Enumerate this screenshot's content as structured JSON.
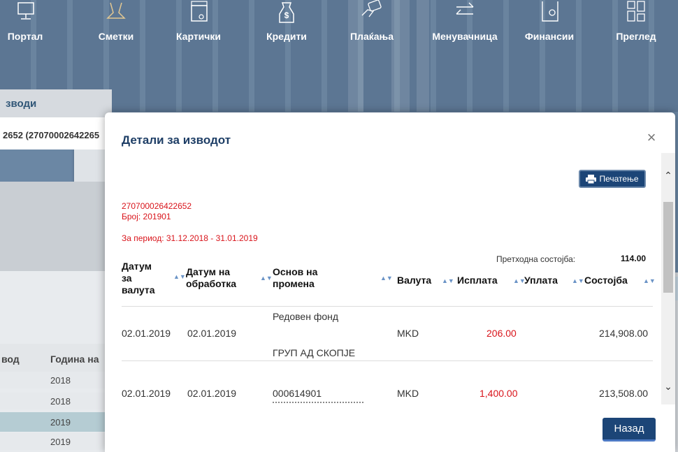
{
  "nav": {
    "items": [
      {
        "label": "Портал",
        "icon": "monitor-icon"
      },
      {
        "label": "Сметки",
        "icon": "users-icon"
      },
      {
        "label": "Картички",
        "icon": "wallet-icon"
      },
      {
        "label": "Кредити",
        "icon": "money-bag-icon"
      },
      {
        "label": "Плаќања",
        "icon": "card-hand-icon"
      },
      {
        "label": "Менувачница",
        "icon": "exchange-icon"
      },
      {
        "label": "Финансии",
        "icon": "safe-icon"
      },
      {
        "label": "Преглед",
        "icon": "dashboard-icon"
      }
    ]
  },
  "background": {
    "section_title": "зводи",
    "account_text": "2652 (27070002642265",
    "col_izvod": "вод",
    "col_year": "Година на",
    "years": [
      "2018",
      "2018",
      "2019",
      "2019"
    ],
    "highlighted_row": 2
  },
  "modal": {
    "title": "Детали за изводот",
    "print_label": "Печатење",
    "account_number": "270700026422652",
    "number_label": "Број:  201901",
    "period_label": "За период:  31.12.2018 - 31.01.2019",
    "prev_balance_label": "Претходна состојба:",
    "prev_balance_value": "114.00",
    "columns": {
      "value_date": "Датум за валута",
      "processing_date": "Датум на обработка",
      "basis": "Основ на промена",
      "currency": "Валута",
      "debit": "Исплата",
      "credit": "Уплата",
      "balance": "Состојба"
    },
    "rows": [
      {
        "value_date": "02.01.2019",
        "processing_date": "02.01.2019",
        "basis_line1": "Редовен фонд",
        "basis_line2": "ГРУП АД СКОПЈЕ",
        "currency": "MKD",
        "debit": "206.00",
        "credit": "",
        "balance": "214,908.00"
      },
      {
        "value_date": "02.01.2019",
        "processing_date": "02.01.2019",
        "basis_line1": "000614901",
        "basis_line2": "",
        "currency": "MKD",
        "debit": "1,400.00",
        "credit": "",
        "balance": "213,508.00"
      }
    ],
    "back_label": "Назад",
    "close_symbol": "×"
  },
  "colors": {
    "accent": "#1c4577",
    "negative": "#d9141b",
    "title": "#1e3e66"
  }
}
